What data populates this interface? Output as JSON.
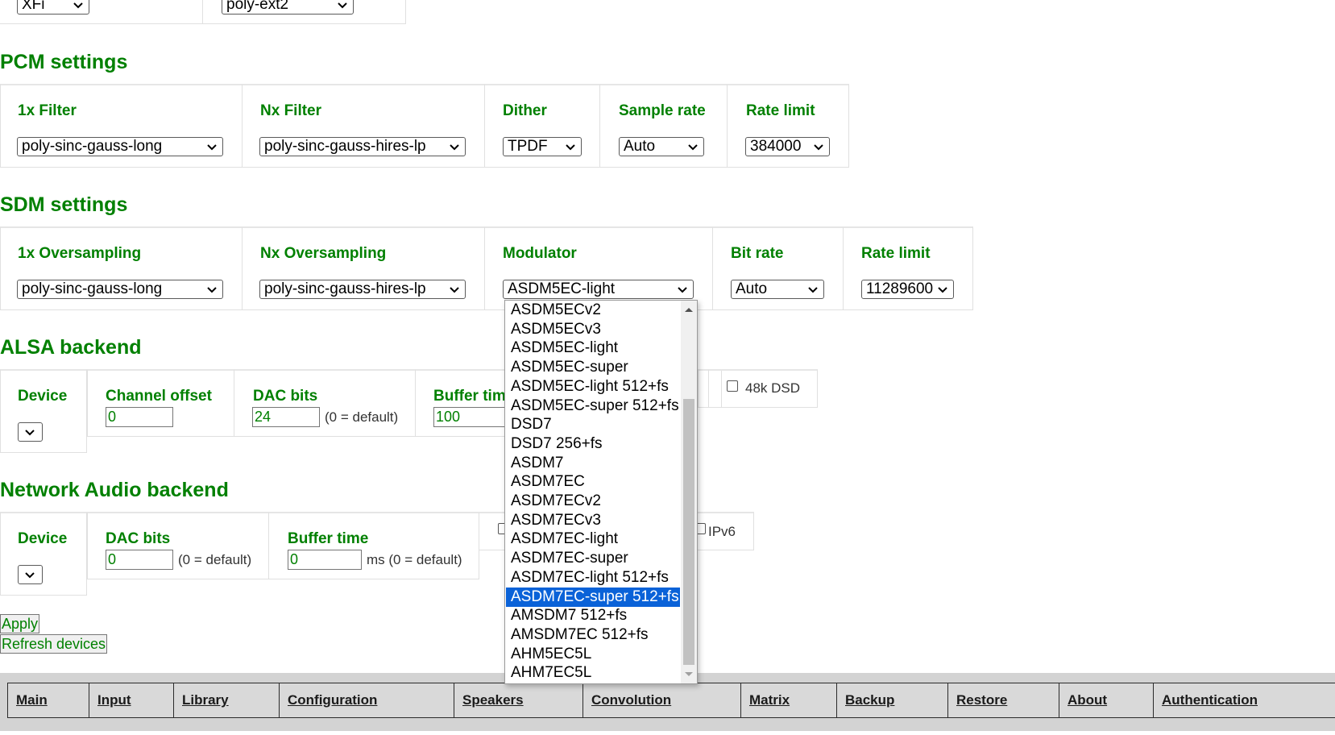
{
  "top_partial": {
    "select1_value": "XFi",
    "select2_value": "poly-ext2"
  },
  "pcm": {
    "heading": "PCM settings",
    "filter1x": {
      "label": "1x Filter",
      "value": "poly-sinc-gauss-long"
    },
    "filterNx": {
      "label": "Nx Filter",
      "value": "poly-sinc-gauss-hires-lp"
    },
    "dither": {
      "label": "Dither",
      "value": "TPDF"
    },
    "sample_rate": {
      "label": "Sample rate",
      "value": "Auto"
    },
    "rate_limit": {
      "label": "Rate limit",
      "value": "384000"
    }
  },
  "sdm": {
    "heading": "SDM settings",
    "os1x": {
      "label": "1x Oversampling",
      "value": "poly-sinc-gauss-long"
    },
    "osNx": {
      "label": "Nx Oversampling",
      "value": "poly-sinc-gauss-hires-lp"
    },
    "modulator": {
      "label": "Modulator",
      "value": "ASDM5EC-light"
    },
    "bit_rate": {
      "label": "Bit rate",
      "value": "Auto"
    },
    "rate_limit": {
      "label": "Rate limit",
      "value": "11289600"
    }
  },
  "alsa": {
    "heading": "ALSA backend",
    "device_label": "Device",
    "channel_offset": {
      "label": "Channel offset",
      "value": "0"
    },
    "dac_bits": {
      "label": "DAC bits",
      "value": "24",
      "hint": "(0 = default)"
    },
    "buffer_time": {
      "label": "Buffer tim",
      "value": "100"
    },
    "dsd48k_label": "48k DSD"
  },
  "network": {
    "heading": "Network Audio backend",
    "device_label": "Device",
    "dac_bits": {
      "label": "DAC bits",
      "value": "0",
      "hint": "(0 = default)"
    },
    "buffer_time": {
      "label": "Buffer time",
      "value": "0",
      "hint": "ms (0 = default)"
    },
    "ipv6_label": "IPv6"
  },
  "buttons": {
    "apply": "Apply",
    "refresh": "Refresh devices"
  },
  "modulator_dropdown": {
    "options": [
      "ASDM5ECv2",
      "ASDM5ECv3",
      "ASDM5EC-light",
      "ASDM5EC-super",
      "ASDM5EC-light 512+fs",
      "ASDM5EC-super 512+fs",
      "DSD7",
      "DSD7 256+fs",
      "ASDM7",
      "ASDM7EC",
      "ASDM7ECv2",
      "ASDM7ECv3",
      "ASDM7EC-light",
      "ASDM7EC-super",
      "ASDM7EC-light 512+fs",
      "ASDM7EC-super 512+fs",
      "AMSDM7 512+fs",
      "AMSDM7EC 512+fs",
      "AHM5EC5L",
      "AHM7EC5L"
    ],
    "highlighted": "ASDM7EC-super 512+fs"
  },
  "nav": [
    "Main",
    "Input",
    "Library",
    "Configuration",
    "Speakers",
    "Convolution",
    "Matrix",
    "Backup",
    "Restore",
    "About",
    "Authentication"
  ],
  "colors": {
    "heading_green": "#008000",
    "highlight_blue": "#0a62d8",
    "nav_bg": "#d3d3d3"
  }
}
